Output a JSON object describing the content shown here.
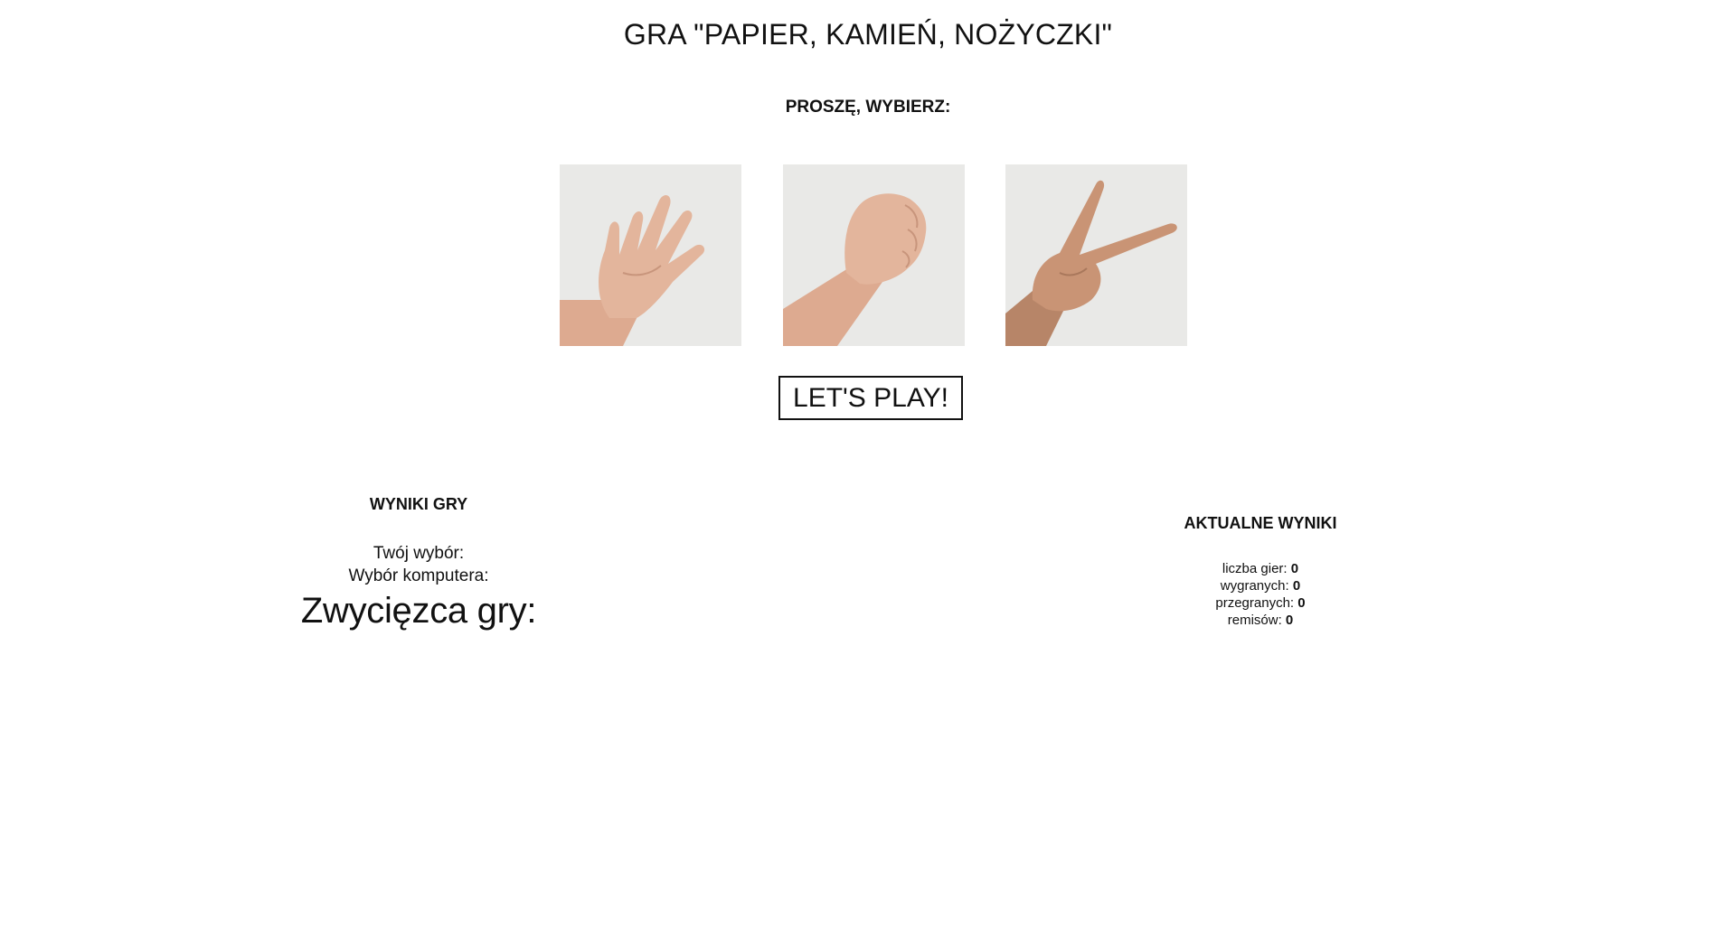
{
  "header": {
    "title": "GRA \"PAPIER, KAMIEŃ, NOŻYCZKI\"",
    "prompt": "PROSZĘ, WYBIERZ:"
  },
  "choices": [
    {
      "name": "papier",
      "icon": "paper-hand-icon"
    },
    {
      "name": "kamień",
      "icon": "rock-fist-icon"
    },
    {
      "name": "nożyczki",
      "icon": "scissors-hand-icon"
    }
  ],
  "play_button": {
    "label": "LET'S PLAY!"
  },
  "game_results": {
    "heading": "WYNIKI GRY",
    "your_choice_label": "Twój wybór:",
    "computer_choice_label": "Wybór komputera:",
    "winner_label": "Zwycięzca gry:"
  },
  "current_results": {
    "heading": "AKTUALNE WYNIKI",
    "games_label": "liczba gier:",
    "games_value": "0",
    "wins_label": "wygranych:",
    "wins_value": "0",
    "losses_label": "przegranych:",
    "losses_value": "0",
    "draws_label": "remisów:",
    "draws_value": "0"
  },
  "colors": {
    "image_background": "#e8e8e6",
    "skin": "#e2b49a",
    "text": "#111111"
  }
}
